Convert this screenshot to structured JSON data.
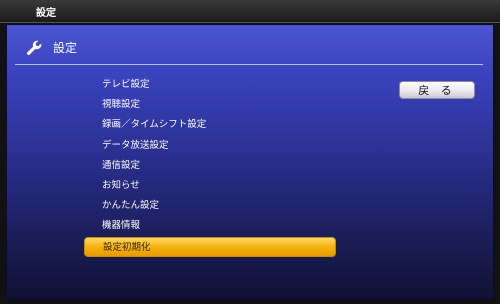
{
  "window": {
    "title": "設定"
  },
  "header": {
    "title": "設定",
    "icon": "wrench-icon"
  },
  "back_button": {
    "label": "戻 る"
  },
  "menu": {
    "items": [
      {
        "label": "テレビ設定"
      },
      {
        "label": "視聴設定"
      },
      {
        "label": "録画／タイムシフト設定"
      },
      {
        "label": "データ放送設定"
      },
      {
        "label": "通信設定"
      },
      {
        "label": "お知らせ"
      },
      {
        "label": "かんたん設定"
      },
      {
        "label": "機器情報"
      },
      {
        "label": "設定初期化",
        "selected": true
      }
    ]
  },
  "colors": {
    "panel_top": "#4b55cf",
    "panel_bottom": "#101133",
    "selected_item": "#f5b20d"
  }
}
